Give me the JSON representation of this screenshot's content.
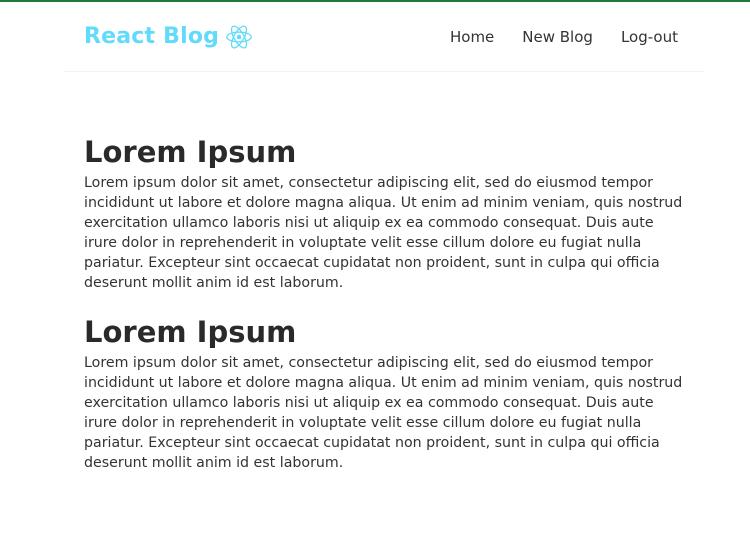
{
  "brand": {
    "title": "React Blog",
    "icon": "react-atom-icon",
    "color": "#61dafb"
  },
  "nav": {
    "links": [
      {
        "label": "Home"
      },
      {
        "label": "New Blog"
      },
      {
        "label": "Log-out"
      }
    ]
  },
  "posts": [
    {
      "title": "Lorem Ipsum",
      "body": "Lorem ipsum dolor sit amet, consectetur adipiscing elit, sed do eiusmod tempor incididunt ut labore et dolore magna aliqua. Ut enim ad minim veniam, quis nostrud exercitation ullamco laboris nisi ut aliquip ex ea commodo consequat. Duis aute irure dolor in reprehenderit in voluptate velit esse cillum dolore eu fugiat nulla pariatur. Excepteur sint occaecat cupidatat non proident, sunt in culpa qui officia deserunt mollit anim id est laborum."
    },
    {
      "title": "Lorem Ipsum",
      "body": "Lorem ipsum dolor sit amet, consectetur adipiscing elit, sed do eiusmod tempor incididunt ut labore et dolore magna aliqua. Ut enim ad minim veniam, quis nostrud exercitation ullamco laboris nisi ut aliquip ex ea commodo consequat. Duis aute irure dolor in reprehenderit in voluptate velit esse cillum dolore eu fugiat nulla pariatur. Excepteur sint occaecat cupidatat non proident, sunt in culpa qui officia deserunt mollit anim id est laborum."
    }
  ]
}
